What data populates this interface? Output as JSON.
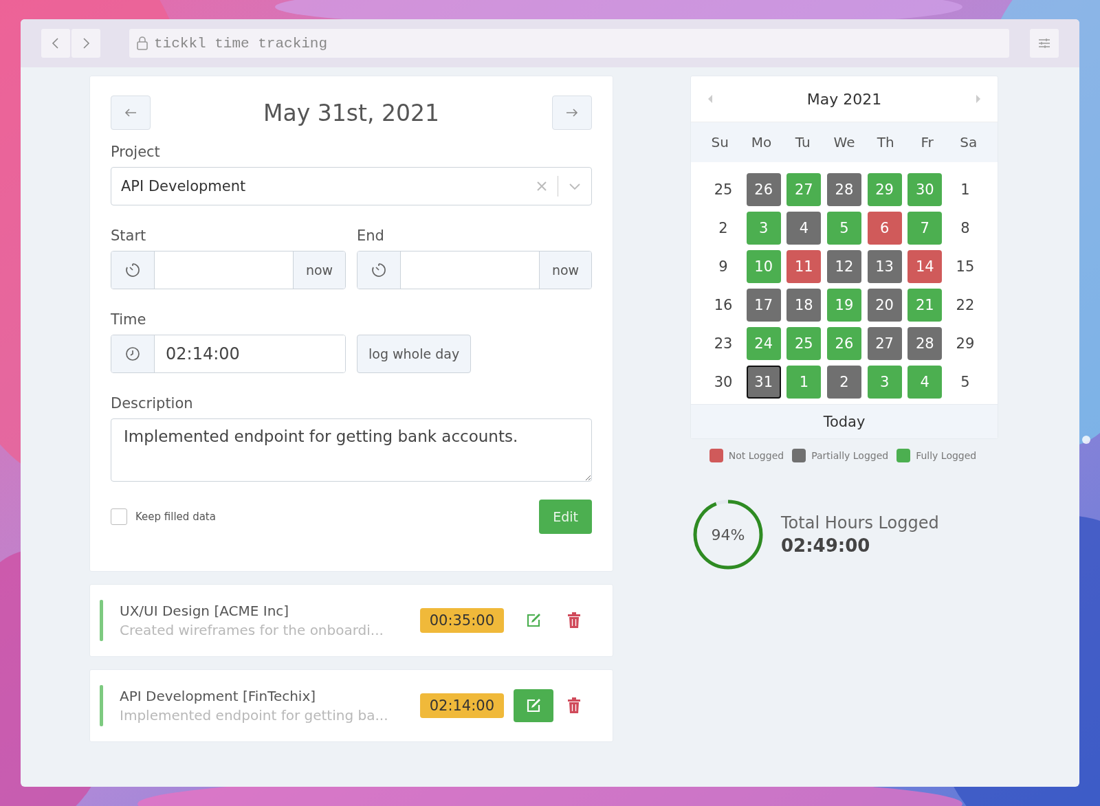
{
  "address_bar": {
    "text": "tickkl time tracking"
  },
  "entry_form": {
    "date": "May 31st, 2021",
    "project_label": "Project",
    "project": "API Development",
    "start_label": "Start",
    "start_button": "now",
    "end_label": "End",
    "end_button": "now",
    "time_label": "Time",
    "time_value": "02:14:00",
    "log_whole_day_button": "log whole day",
    "description_label": "Description",
    "description_value": "Implemented endpoint for getting bank accounts.",
    "keep_filled": {
      "label": "Keep filled data",
      "checked": false
    },
    "submit_button": "Edit"
  },
  "entries": [
    {
      "title": "UX/UI Design [ACME Inc]",
      "description": "Created wireframes for the onboardi...",
      "duration": "00:35:00",
      "editing": false
    },
    {
      "title": "API Development [FinTechix]",
      "description": "Implemented endpoint for getting ba...",
      "duration": "02:14:00",
      "editing": true
    }
  ],
  "calendar": {
    "title": "May 2021",
    "weekdays": [
      "Su",
      "Mo",
      "Tu",
      "We",
      "Th",
      "Fr",
      "Sa"
    ],
    "weeks": [
      [
        {
          "day": "25",
          "selected": false
        },
        {
          "day": "26",
          "color": "#707070",
          "selected": false
        },
        {
          "day": "27",
          "color": "#4caf50",
          "selected": false
        },
        {
          "day": "28",
          "color": "#707070",
          "selected": false
        },
        {
          "day": "29",
          "color": "#4caf50",
          "selected": false
        },
        {
          "day": "30",
          "color": "#4caf50",
          "selected": false
        },
        {
          "day": "1",
          "selected": false
        }
      ],
      [
        {
          "day": "2",
          "selected": false
        },
        {
          "day": "3",
          "color": "#4caf50",
          "selected": false
        },
        {
          "day": "4",
          "color": "#707070",
          "selected": false
        },
        {
          "day": "5",
          "color": "#4caf50",
          "selected": false
        },
        {
          "day": "6",
          "color": "#d05a5a",
          "selected": false
        },
        {
          "day": "7",
          "color": "#4caf50",
          "selected": false
        },
        {
          "day": "8",
          "selected": false
        }
      ],
      [
        {
          "day": "9",
          "selected": false
        },
        {
          "day": "10",
          "color": "#4caf50",
          "selected": false
        },
        {
          "day": "11",
          "color": "#d05a5a",
          "selected": false
        },
        {
          "day": "12",
          "color": "#707070",
          "selected": false
        },
        {
          "day": "13",
          "color": "#707070",
          "selected": false
        },
        {
          "day": "14",
          "color": "#d05a5a",
          "selected": false
        },
        {
          "day": "15",
          "selected": false
        }
      ],
      [
        {
          "day": "16",
          "selected": false
        },
        {
          "day": "17",
          "color": "#707070",
          "selected": false
        },
        {
          "day": "18",
          "color": "#707070",
          "selected": false
        },
        {
          "day": "19",
          "color": "#4caf50",
          "selected": false
        },
        {
          "day": "20",
          "color": "#707070",
          "selected": false
        },
        {
          "day": "21",
          "color": "#4caf50",
          "selected": false
        },
        {
          "day": "22",
          "selected": false
        }
      ],
      [
        {
          "day": "23",
          "selected": false
        },
        {
          "day": "24",
          "color": "#4caf50",
          "selected": false
        },
        {
          "day": "25",
          "color": "#4caf50",
          "selected": false
        },
        {
          "day": "26",
          "color": "#4caf50",
          "selected": false
        },
        {
          "day": "27",
          "color": "#707070",
          "selected": false
        },
        {
          "day": "28",
          "color": "#707070",
          "selected": false
        },
        {
          "day": "29",
          "selected": false
        }
      ],
      [
        {
          "day": "30",
          "selected": false
        },
        {
          "day": "31",
          "color": "#707070",
          "selected": true
        },
        {
          "day": "1",
          "color": "#4caf50",
          "selected": false
        },
        {
          "day": "2",
          "color": "#707070",
          "selected": false
        },
        {
          "day": "3",
          "color": "#4caf50",
          "selected": false
        },
        {
          "day": "4",
          "color": "#4caf50",
          "selected": false
        },
        {
          "day": "5",
          "selected": false
        }
      ]
    ],
    "today_button": "Today"
  },
  "legend": [
    {
      "label": "Not Logged",
      "color": "#d05a5a"
    },
    {
      "label": "Partially Logged",
      "color": "#707070"
    },
    {
      "label": "Fully Logged",
      "color": "#4caf50"
    }
  ],
  "summary": {
    "percent": "94%",
    "level": 0.94,
    "title": "Total Hours Logged",
    "total": "02:49:00"
  }
}
